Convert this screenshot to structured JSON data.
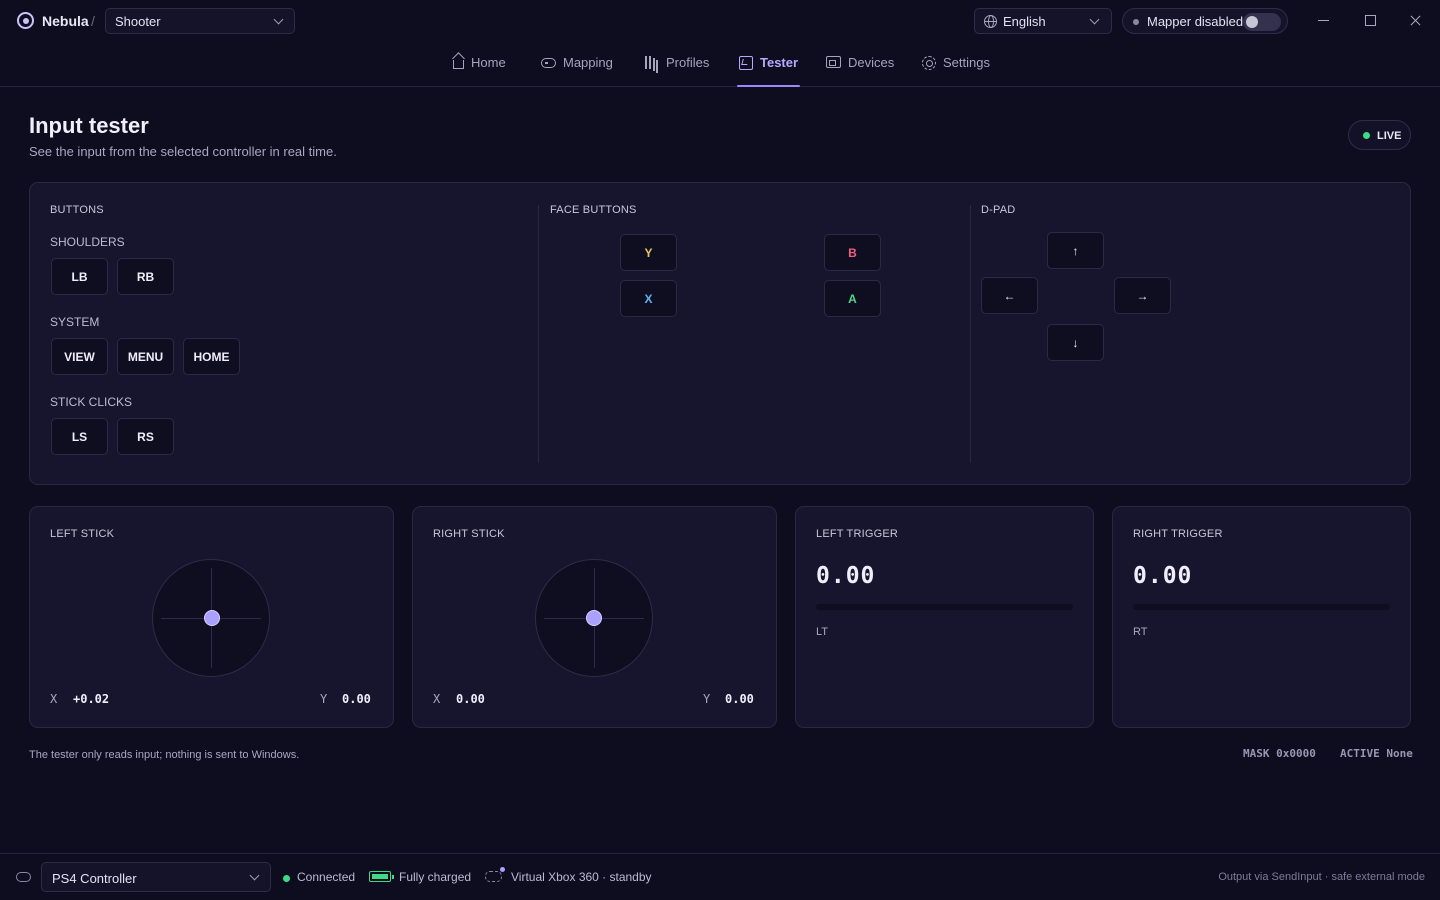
{
  "titlebar": {
    "app_name": "Nebula",
    "separator": "/",
    "profile": "Shooter",
    "language": "English",
    "mapper_status": "Mapper disabled",
    "mapper_enabled": false
  },
  "nav": {
    "tabs": [
      {
        "label": "Home",
        "icon": "home-icon"
      },
      {
        "label": "Mapping",
        "icon": "gamepad-icon"
      },
      {
        "label": "Profiles",
        "icon": "profiles-icon"
      },
      {
        "label": "Tester",
        "icon": "tester-icon",
        "active": true
      },
      {
        "label": "Devices",
        "icon": "devices-icon"
      },
      {
        "label": "Settings",
        "icon": "gear-icon"
      }
    ]
  },
  "page": {
    "title": "Input tester",
    "subtitle": "See the input from the selected controller in real time.",
    "live_badge": "LIVE"
  },
  "buttons_panel": {
    "title": "BUTTONS",
    "shoulders_label": "SHOULDERS",
    "shoulders": [
      "LB",
      "RB"
    ],
    "system_label": "SYSTEM",
    "system": [
      "VIEW",
      "MENU",
      "HOME"
    ],
    "stick_clicks_label": "STICK CLICKS",
    "stick_clicks": [
      "LS",
      "RS"
    ]
  },
  "face_buttons": {
    "title": "FACE BUTTONS",
    "y": "Y",
    "b": "B",
    "x": "X",
    "a": "A",
    "colors": {
      "y": "#e8c75a",
      "b": "#f0607a",
      "x": "#5fb4f0",
      "a": "#4fd68a"
    }
  },
  "dpad": {
    "title": "D-PAD",
    "up": "↑",
    "left": "←",
    "right": "→",
    "down": "↓"
  },
  "left_stick": {
    "title": "LEFT STICK",
    "x_label": "X",
    "x_value": "+0.02",
    "y_label": "Y",
    "y_value": "0.00",
    "x": 0.02,
    "y": 0.0
  },
  "right_stick": {
    "title": "RIGHT STICK",
    "x_label": "X",
    "x_value": "0.00",
    "y_label": "Y",
    "y_value": "0.00",
    "x": 0.0,
    "y": 0.0
  },
  "left_trigger": {
    "title": "LEFT TRIGGER",
    "value_text": "0.00",
    "value": 0.0,
    "code": "LT"
  },
  "right_trigger": {
    "title": "RIGHT TRIGGER",
    "value_text": "0.00",
    "value": 0.0,
    "code": "RT"
  },
  "footer": {
    "note": "The tester only reads input; nothing is sent to Windows.",
    "mask": "MASK 0x0000",
    "active": "ACTIVE None"
  },
  "statusbar": {
    "device": "PS4 Controller",
    "connection": "Connected",
    "battery": "Fully charged",
    "virtual": "Virtual Xbox 360 · standby",
    "output": "Output via SendInput · safe external mode"
  },
  "colors": {
    "accent": "#9d87ff",
    "connected": "#3ddc84",
    "background": "#0e0c1f",
    "card": "#17152d"
  }
}
